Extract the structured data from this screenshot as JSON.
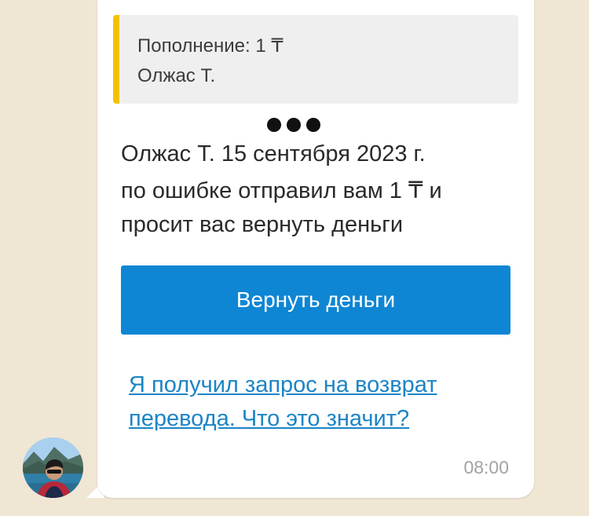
{
  "quote": {
    "line1": "Пополнение: 1 ₸",
    "line2": "Олжас Т."
  },
  "message": {
    "line1": "Олжас Т. 15 сентября 2023 г.",
    "line2": "по ошибке отправил вам 1 ₸ и",
    "line3": "просит вас вернуть деньги"
  },
  "button": {
    "label": "Вернуть деньги"
  },
  "help_link": {
    "line1": "Я получил запрос на возврат",
    "line2": "перевода. Что это значит?"
  },
  "timestamp": "08:00",
  "icons": {
    "typing": "ellipsis-icon",
    "avatar": "user-avatar-photo"
  },
  "colors": {
    "background": "#efe6d4",
    "bubble": "#ffffff",
    "quote_bar": "#f2c200",
    "button": "#0e86d4",
    "link": "#1c84c6",
    "timestamp": "#a2a2a2"
  }
}
